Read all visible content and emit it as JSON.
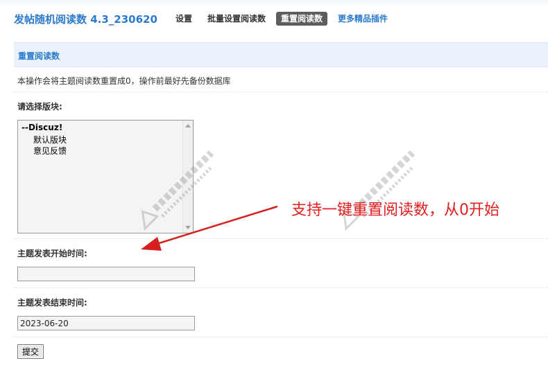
{
  "header": {
    "title": "发帖随机阅读数 4.3_230620",
    "nav": [
      {
        "label": "设置",
        "state": "normal"
      },
      {
        "label": "批量设置阅读数",
        "state": "normal"
      },
      {
        "label": "重置阅读数",
        "state": "active"
      },
      {
        "label": "更多精品插件",
        "state": "accent"
      }
    ]
  },
  "section": {
    "title": "重置阅读数",
    "note": "本操作会将主题阅读数重置成0，操作前最好先备份数据库"
  },
  "form": {
    "forum_label": "请选择版块:",
    "forum_options": [
      {
        "label": "--Discuz!",
        "group": true
      },
      {
        "label": "默认版块",
        "group": false
      },
      {
        "label": "意见反馈",
        "group": false
      }
    ],
    "start_label": "主题发表开始时间:",
    "start_value": "",
    "end_label": "主题发表结束时间:",
    "end_value": "2023-06-20",
    "submit_label": "提交"
  },
  "annotation": {
    "text": "支持一键重置阅读数，从0开始"
  },
  "colors": {
    "accent": "#2b7acd",
    "annotation": "#e41e1e",
    "active_tab": "#5d5d5d"
  }
}
